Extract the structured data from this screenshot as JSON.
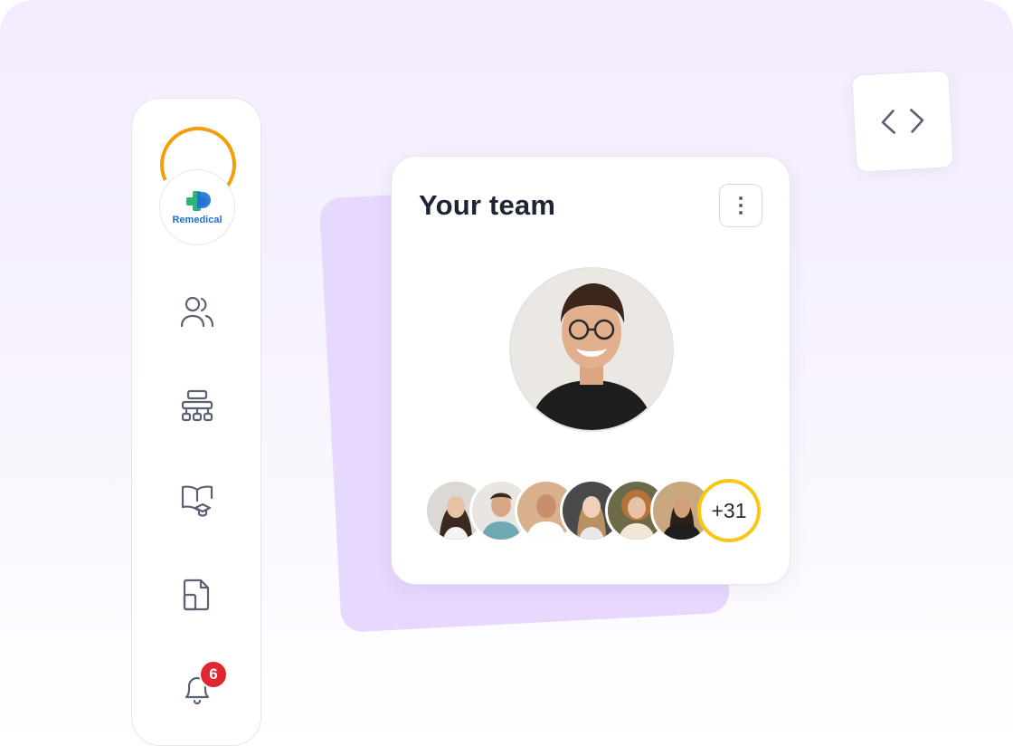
{
  "brand": {
    "name": "Remedical",
    "accent": "#f59e0b",
    "text_color": "#1f6fd6"
  },
  "sidebar": {
    "items": [
      {
        "icon": "users-icon",
        "label": "Team"
      },
      {
        "icon": "org-chart-icon",
        "label": "Organization"
      },
      {
        "icon": "learning-book-icon",
        "label": "Learning"
      },
      {
        "icon": "documents-icon",
        "label": "Documents"
      },
      {
        "icon": "bell-icon",
        "label": "Notifications"
      }
    ],
    "notification_count": "6"
  },
  "team_card": {
    "title": "Your team",
    "more_count": "+31",
    "member_count_shown": 6
  },
  "code_button": {
    "icon": "code-icon"
  },
  "colors": {
    "background": "#f3ecfe",
    "back_card": "#e7d8fd",
    "badge": "#e0262e",
    "more_ring": "#f7c714",
    "icon_stroke": "#5b6172"
  }
}
